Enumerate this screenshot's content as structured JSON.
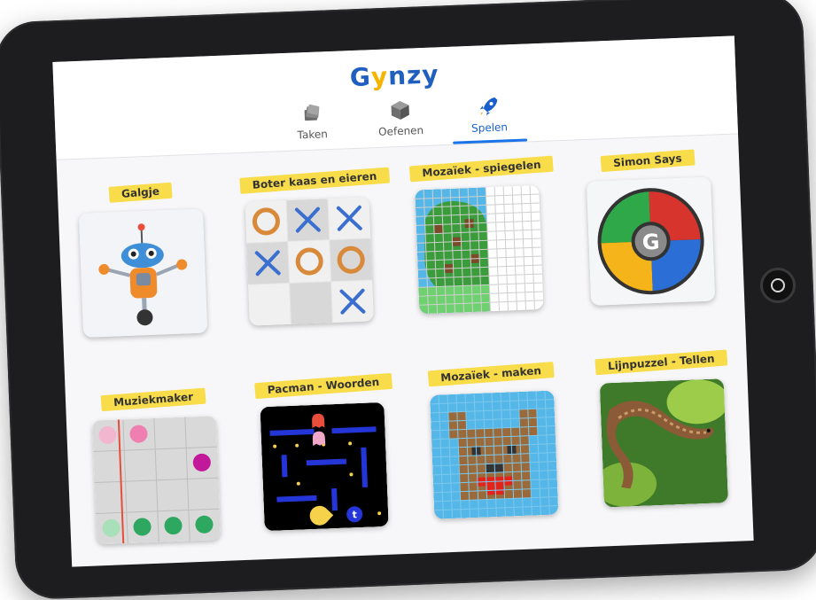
{
  "header": {
    "logo": {
      "part1": "G",
      "part2": "y",
      "part3": "nzy"
    },
    "tabs": [
      {
        "label": "Taken",
        "icon": "stack-icon"
      },
      {
        "label": "Oefenen",
        "icon": "cube-icon"
      },
      {
        "label": "Spelen",
        "icon": "rocket-icon",
        "active": true
      }
    ]
  },
  "games": [
    {
      "label": "Galgje",
      "icon": "robot-icon"
    },
    {
      "label": "Boter kaas en eieren",
      "icon": "tictactoe-icon"
    },
    {
      "label": "Mozaïek - spiegelen",
      "icon": "mosaic-tree-icon"
    },
    {
      "label": "Simon Says",
      "icon": "simon-icon",
      "center_letter": "G"
    },
    {
      "label": "Muziekmaker",
      "icon": "music-grid-icon"
    },
    {
      "label": "Pacman - Woorden",
      "icon": "pacman-icon",
      "badge_letter": "t"
    },
    {
      "label": "Mozaïek - maken",
      "icon": "mosaic-dog-icon"
    },
    {
      "label": "Lijnpuzzel - Tellen",
      "icon": "snake-photo-icon"
    }
  ],
  "colors": {
    "brand_blue": "#1f5fbf",
    "brand_yellow": "#f4b400",
    "label_yellow": "#f8dc4a",
    "active_tab": "#1a73e8"
  }
}
